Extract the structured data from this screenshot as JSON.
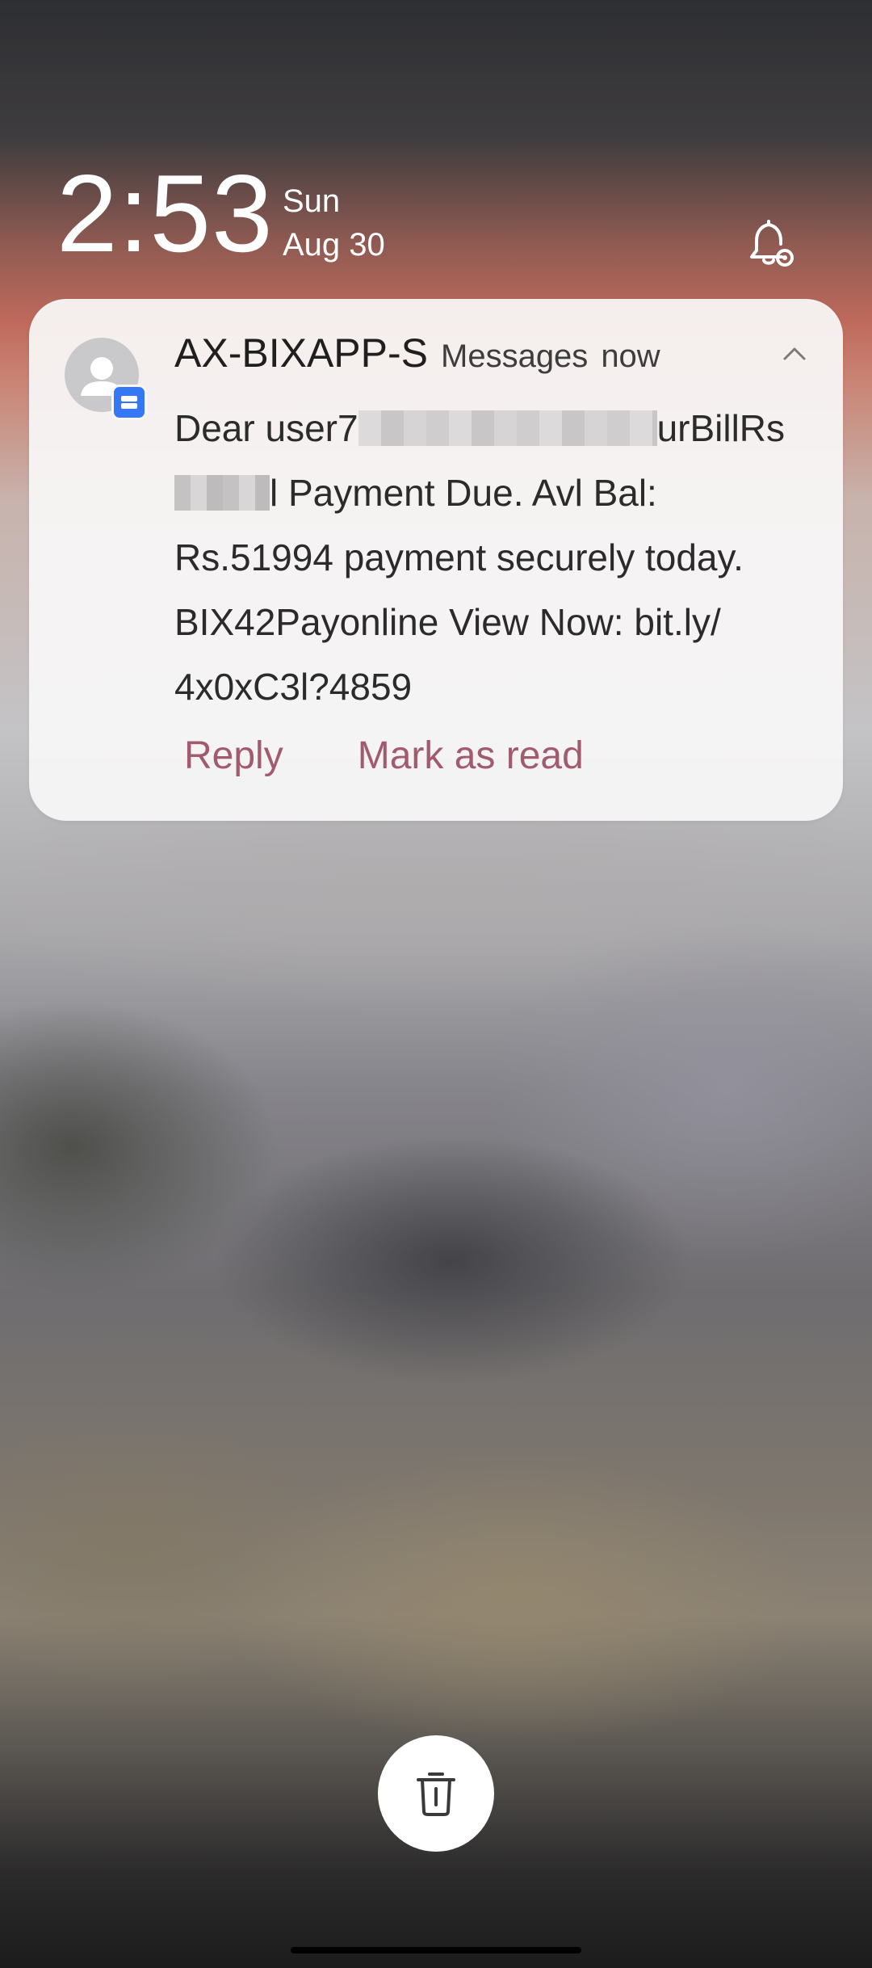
{
  "lockscreen": {
    "time": "2:53",
    "day": "Sun",
    "date": "Aug 30"
  },
  "notification": {
    "sender": "AX-BIXAPP-S",
    "app_name": "Messages",
    "timestamp": "now",
    "message_lines": [
      {
        "before": "Dear user7",
        "after": "urBillRs"
      },
      {
        "before": "",
        "after": "l Payment Due. Avl Bal:"
      },
      {
        "text": "Rs.51994 payment securely today."
      },
      {
        "text": "BIX42Payonline View Now: bit.ly/"
      },
      {
        "text": "4x0xC3l?4859"
      }
    ],
    "actions": {
      "reply_label": "Reply",
      "mark_read_label": "Mark as read"
    },
    "accent_color": "#a25a6e",
    "badge_color": "#3478f6"
  },
  "icons": {
    "bell": "bell-settings-icon",
    "avatar": "person-icon",
    "badge": "message-icon",
    "collapse": "chevron-up-icon",
    "trash": "trash-icon"
  }
}
